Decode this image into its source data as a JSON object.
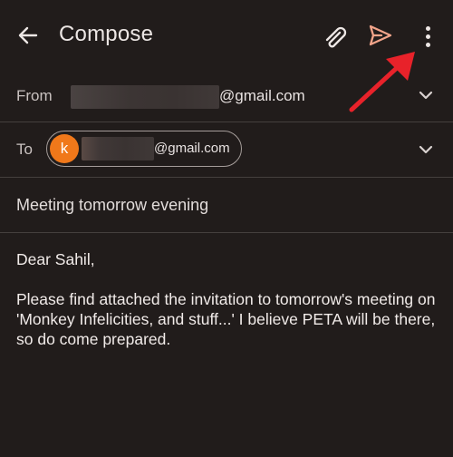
{
  "appbar": {
    "title": "Compose",
    "back_icon": "arrow-back-icon",
    "attach_icon": "paperclip-icon",
    "send_icon": "send-icon",
    "more_icon": "more-vert-icon"
  },
  "from": {
    "label": "From",
    "address_suffix": "@gmail.com"
  },
  "to": {
    "label": "To",
    "recipient": {
      "avatar_letter": "k",
      "address_suffix": "@gmail.com"
    }
  },
  "subject": "Meeting tomorrow evening",
  "body": {
    "greeting": "Dear Sahil,",
    "paragraph": "Please find attached the invitation to tomorrow's meeting on 'Monkey Infelicities, and stuff...' I believe PETA will be there, so do come prepared."
  },
  "colors": {
    "background": "#211c1b",
    "send_accent": "#f2a48a",
    "avatar": "#f0781a",
    "annotation_arrow": "#e8222a"
  }
}
